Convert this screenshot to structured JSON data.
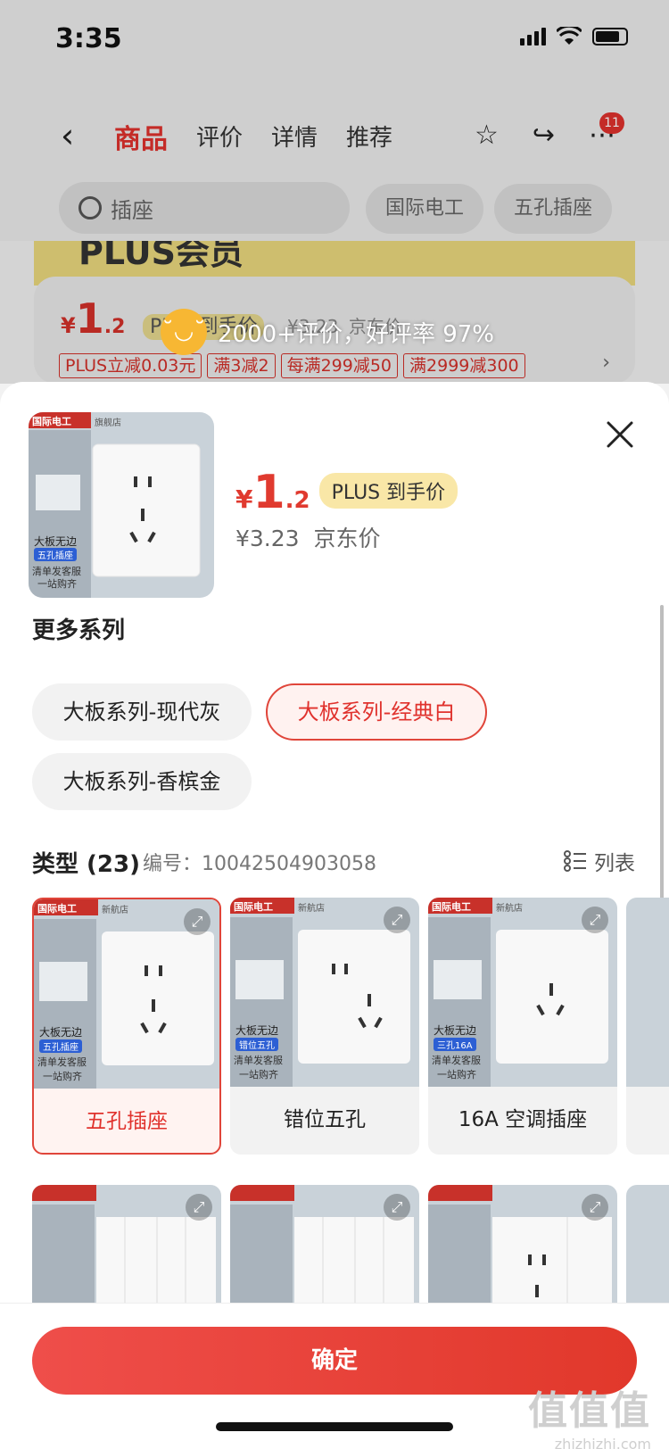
{
  "status": {
    "time": "3:35"
  },
  "nav": {
    "tabs": [
      "商品",
      "评价",
      "详情",
      "推荐"
    ],
    "badge_count": "11"
  },
  "search": {
    "value": "插座",
    "chips": [
      "国际电工",
      "五孔插座"
    ]
  },
  "promo": {
    "text": "PLUS会员"
  },
  "bg_price": {
    "symbol": "¥",
    "integer": "1",
    "decimal": ".2",
    "plus_label": "PLUS到手价",
    "jd_price": "¥3.23",
    "jd_label": "京东价",
    "tags": [
      "PLUS立减0.03元",
      "满3减2",
      "每满299减50",
      "满2999减300"
    ]
  },
  "review": {
    "text": "2000+评价，好评率 97%"
  },
  "sheet": {
    "price_symbol": "¥",
    "price_integer": "1",
    "price_decimal": ".2",
    "plus_tag": "PLUS 到手价",
    "jd_price": "¥3.23",
    "jd_label": "京东价",
    "thumb_text": {
      "brand": "国际电工",
      "store": "旗舰店",
      "line1": "大板无边",
      "line2": "五孔插座",
      "line3": "清单发客服",
      "line4": "一站购齐"
    },
    "series_title": "更多系列",
    "series": [
      "大板系列-现代灰",
      "大板系列-经典白",
      "大板系列-香槟金"
    ],
    "selected_series": "大板系列-经典白",
    "type_title": "类型 (23)",
    "type_number_label": "编号：",
    "type_number": "10042504903058",
    "list_label": "列表",
    "types": [
      {
        "label": "五孔插座",
        "badge": "五孔插座",
        "selected": true
      },
      {
        "label": "错位五孔",
        "badge": "错位五孔",
        "selected": false
      },
      {
        "label": "16A 空调插座",
        "badge": "三孔16A",
        "selected": false
      }
    ],
    "card_brand": "国际电工",
    "card_store": "新航店",
    "card_line1": "大板无边",
    "card_line3": "清单发客服",
    "card_line4": "一站购齐",
    "confirm": "确定"
  },
  "watermark": {
    "big": "值值值",
    "small": "zhizhizhi.com"
  },
  "colors": {
    "accent": "#e0322d",
    "plus": "#f9e7a7"
  }
}
